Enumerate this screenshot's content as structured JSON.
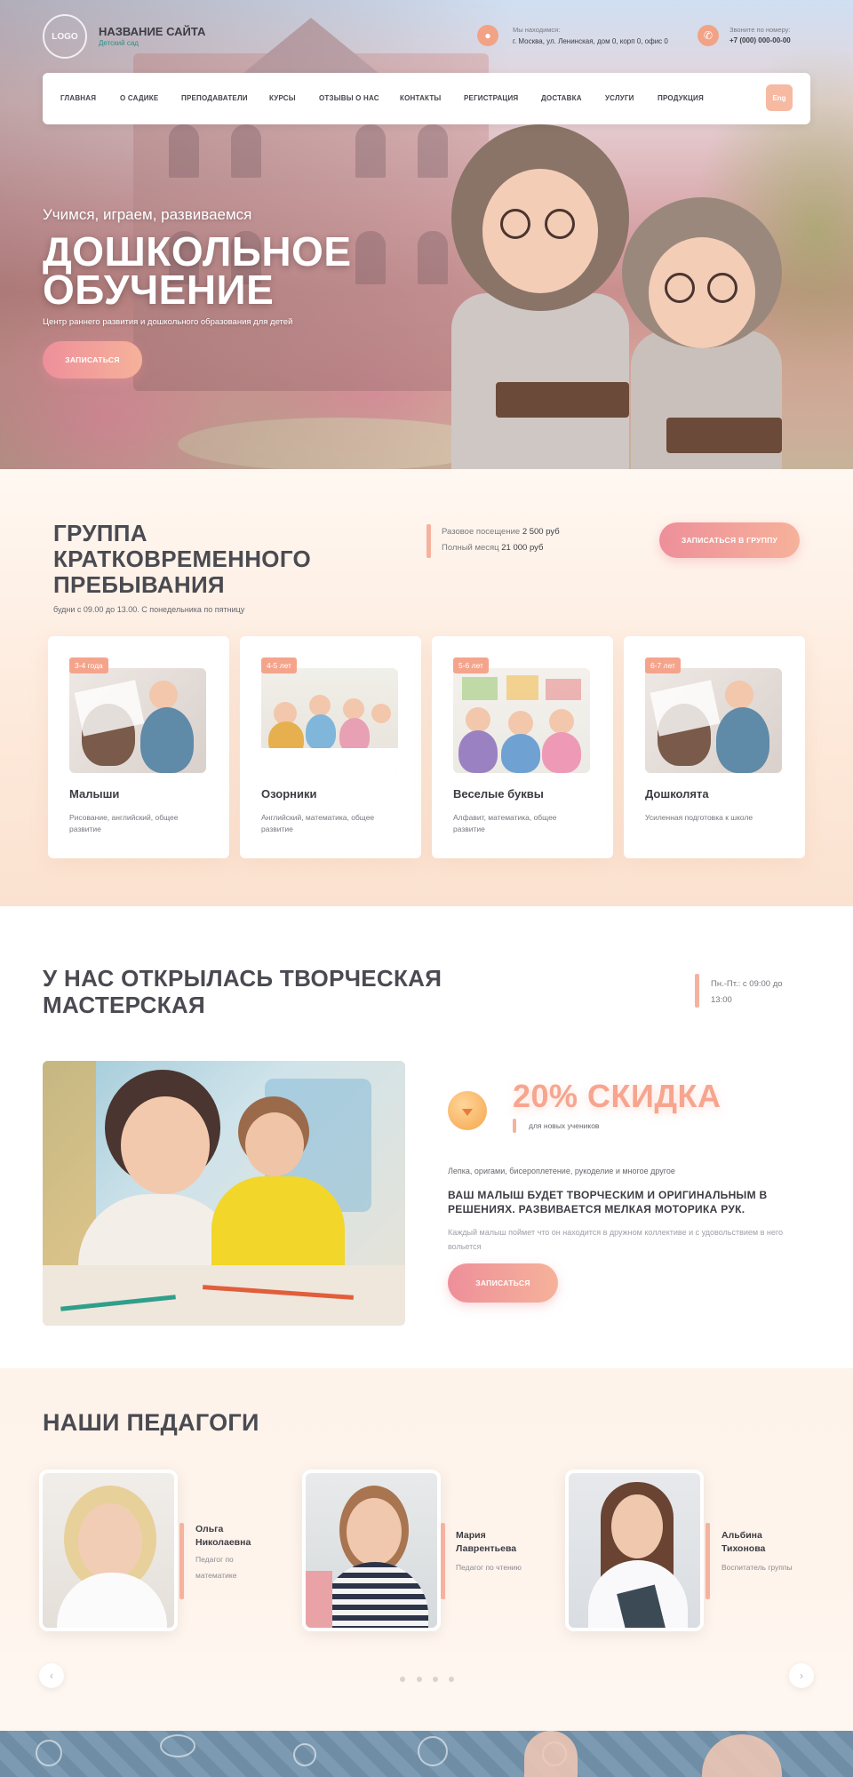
{
  "header": {
    "logo_text": "LOGO",
    "site_title": "НАЗВАНИЕ САЙТА",
    "site_subtitle": "Детский сад",
    "location_label": "Мы находимся:",
    "location_value": "г. Москва, ул. Ленинская, дом 0, корп 0, офис 0",
    "phone_label": "Звоните по номеру:",
    "phone_value": "+7 (000) 000-00-00"
  },
  "nav": {
    "items": [
      "ГЛАВНАЯ",
      "О САДИКЕ",
      "ПРЕПОДАВАТЕЛИ",
      "КУРСЫ",
      "ОТЗЫВЫ О НАС",
      "КОНТАКТЫ",
      "РЕГИСТРАЦИЯ",
      "ДОСТАВКА",
      "УСЛУГИ",
      "ПРОДУКЦИЯ"
    ],
    "lang": "Eng"
  },
  "hero": {
    "kicker": "Учимся, играем, развиваемся",
    "title_line1": "ДОШКОЛЬНОЕ",
    "title_line2": "ОБУЧЕНИЕ",
    "description": "Центр раннего развития и дошкольного образования для детей",
    "cta": "ЗАПИСАТЬСЯ"
  },
  "group": {
    "title_line1": "ГРУППА",
    "title_line2": "КРАТКОВРЕМЕННОГО",
    "title_line3": "ПРЕБЫВАНИЯ",
    "schedule": "будни с 09.00 до 13.00. С понедельника по пятницу",
    "single_label": "Разовое посещение",
    "single_price": "2 500 руб",
    "month_label": "Полный месяц",
    "month_price": "21 000 руб",
    "cta": "ЗАПИСАТЬСЯ В ГРУППУ",
    "cards": [
      {
        "age": "3-4 года",
        "title": "Малыши",
        "desc": "Рисование, английский, общее развитие"
      },
      {
        "age": "4-5 лет",
        "title": "Озорники",
        "desc": "Английский, математика, общее развитие"
      },
      {
        "age": "5-6 лет",
        "title": "Веселые буквы",
        "desc": "Алфавит, математика, общее развитие"
      },
      {
        "age": "6-7 лет",
        "title": "Дошколята",
        "desc": "Усиленная подготовка к школе"
      }
    ]
  },
  "workshop": {
    "title_line1": "У НАС ОТКРЫЛАСЬ ТВОРЧЕСКАЯ",
    "title_line2": "МАСТЕРСКАЯ",
    "hours_line1": "Пн.-Пт.: с 09:00 до",
    "hours_line2": "13:00",
    "discount": "20% СКИДКА",
    "discount_note": "для новых учеников",
    "activities": "Лепка, оригами, бисероплетение, рукоделие и многое другое",
    "headline_line1": "ВАШ МАЛЫШ БУДЕТ ТВОРЧЕСКИМ И ОРИГИНАЛЬНЫМ В",
    "headline_line2": "РЕШЕНИЯХ. РАЗВИВАЕТСЯ МЕЛКАЯ МОТОРИКА РУК.",
    "text": "Каждый малыш поймет что он находится в дружном коллективе и с удовольствием в него вольется",
    "cta": "ЗАПИСАТЬСЯ"
  },
  "teachers": {
    "title": "НАШИ ПЕДАГОГИ",
    "items": [
      {
        "name_line1": "Ольга",
        "name_line2": "Николаевна",
        "role_line1": "Педагог  по",
        "role_line2": "математике"
      },
      {
        "name_line1": "Мария",
        "name_line2": "Лаврентьева",
        "role_line1": "Педагог по чтению",
        "role_line2": ""
      },
      {
        "name_line1": "Альбина",
        "name_line2": "Тихонова",
        "role_line1": "Воспитатель группы",
        "role_line2": ""
      }
    ],
    "prev_icon": "chevron-left-icon",
    "next_icon": "chevron-right-icon"
  },
  "colors": {
    "accent": "#f5a48c",
    "accent_pink": "#ee8f9a",
    "text_dark": "#4a4a52",
    "teal": "#2f8f85"
  }
}
